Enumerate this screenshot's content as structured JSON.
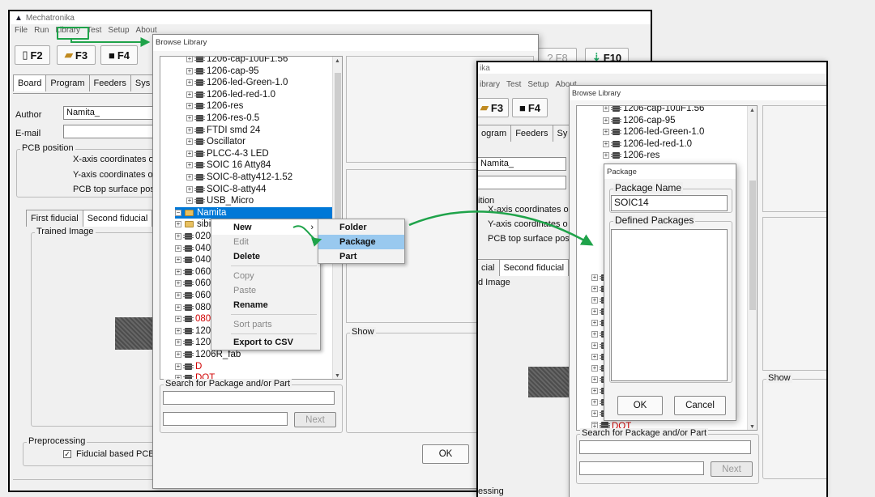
{
  "app": {
    "title": "Mechatronika",
    "menus": [
      "File",
      "Run",
      "Library",
      "Test",
      "Setup",
      "About"
    ]
  },
  "toolbar": {
    "f2": "F2",
    "f3": "F3",
    "f4": "F4",
    "f8": "F8",
    "f10": "F10",
    "icon_f2": "page-icon",
    "icon_f3": "open-folder-icon",
    "icon_f4": "save-icon"
  },
  "tabs": [
    "Board",
    "Program",
    "Feeders",
    "Sys"
  ],
  "form": {
    "author_label": "Author",
    "author_value": "Namita_",
    "email_label": "E-mail",
    "pcb_position": "PCB position",
    "x_axis": "X-axis coordinates o",
    "y_axis": "Y-axis coordinates o",
    "pcb_top": "PCB top surface pos"
  },
  "fiducial_tabs": [
    "First fiducial",
    "Second fiducial"
  ],
  "trained_image": "Trained Image",
  "preprocessing": {
    "label": "Preprocessing",
    "checkbox": "Fiducial based PCB",
    "checked": true
  },
  "browse": {
    "title": "Browse Library",
    "ok": "OK",
    "show": "Show",
    "search_label": "Search for Package and/or Part",
    "next": "Next"
  },
  "tree_top": [
    "1206-cap-10uF1.56",
    "1206-cap-95",
    "1206-led-Green-1.0",
    "1206-led-red-1.0",
    "1206-res",
    "1206-res-0.5",
    "FTDI smd 24",
    "Oscillator",
    "PLCC-4-3 LED",
    "SOIC 16 Atty84",
    "SOIC-8-atty412-1.52",
    "SOIC-8-atty44",
    "USB_Micro"
  ],
  "tree_selected": "Namita",
  "tree_after": [
    {
      "t": "sibi",
      "red": false,
      "folder": true
    },
    {
      "t": "020",
      "red": false
    },
    {
      "t": "040",
      "red": false
    },
    {
      "t": "040",
      "red": false
    },
    {
      "t": "060",
      "red": false
    },
    {
      "t": "060",
      "red": false
    },
    {
      "t": "060",
      "red": false
    },
    {
      "t": "080",
      "red": false
    },
    {
      "t": "080",
      "red": true
    },
    {
      "t": "120",
      "red": false
    },
    {
      "t": "120",
      "red": false
    },
    {
      "t": "1206R_fab",
      "red": false
    },
    {
      "t": "D",
      "red": true
    },
    {
      "t": "DOT",
      "red": true
    }
  ],
  "context_menu": {
    "items": [
      "New",
      "Edit",
      "Delete",
      "Copy",
      "Paste",
      "Rename",
      "Sort parts",
      "Export to CSV"
    ],
    "new_submenu": [
      "Folder",
      "Package",
      "Part"
    ]
  },
  "package_dialog": {
    "title": "Package",
    "name_label": "Package Name",
    "name_value": "SOIC14",
    "defined_label": "Defined Packages",
    "ok": "OK",
    "cancel": "Cancel"
  },
  "shot2": {
    "title": "ika",
    "menus": [
      "ibrary",
      "Test",
      "Setup",
      "About"
    ],
    "f3": "F3",
    "f4": "F4",
    "tabs": [
      "ogram",
      "Feeders",
      "Sy"
    ],
    "author_value": "Namita_",
    "pos_label": "ition",
    "x_axis": "X-axis coordinates o",
    "y_axis": "Y-axis coordinates o",
    "pcb_top": "PCB top surface pos",
    "fid_tabs": [
      "cial",
      "Second fiducial"
    ],
    "image": "d Image",
    "processing": "essing",
    "tree": [
      "1206-cap-10uF1.56",
      "1206-cap-95",
      "1206-led-Green-1.0",
      "1206-led-red-1.0",
      "1206-res"
    ],
    "dot": "DOT",
    "show": "Show",
    "search_label": "Search for Package and/or Part",
    "next": "Next"
  },
  "colors": {
    "highlight": "#1fa34a",
    "selection": "#0078d7",
    "menu_hover": "#99c9ef",
    "red_text": "#d00000"
  }
}
